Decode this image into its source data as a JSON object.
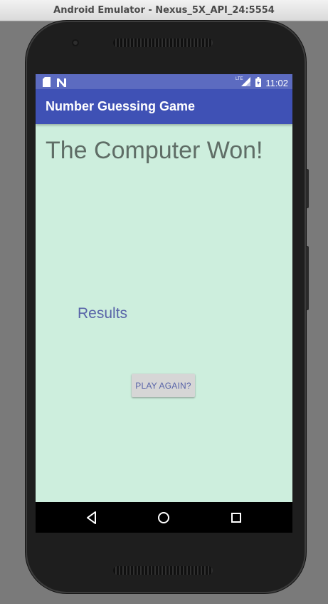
{
  "window": {
    "title": "Android Emulator - Nexus_5X_API_24:5554"
  },
  "status_bar": {
    "time": "11:02",
    "network_label": "LTE",
    "icons": [
      "sd-card-icon",
      "n-notification-icon",
      "signal-icon",
      "battery-icon"
    ]
  },
  "app_bar": {
    "title": "Number Guessing Game"
  },
  "main": {
    "headline": "The Computer Won!",
    "results_label": "Results",
    "play_again_label": "PLAY AGAIN?"
  },
  "nav_bar": {
    "buttons": [
      "back-icon",
      "home-icon",
      "recents-icon"
    ]
  },
  "colors": {
    "status_bar": "#5c6bc0",
    "app_bar": "#3f51b5",
    "screen_background": "#cdeedd",
    "headline_text": "#5f6d66",
    "accent_text": "#5864a8",
    "button_background": "#d6d6d6"
  }
}
